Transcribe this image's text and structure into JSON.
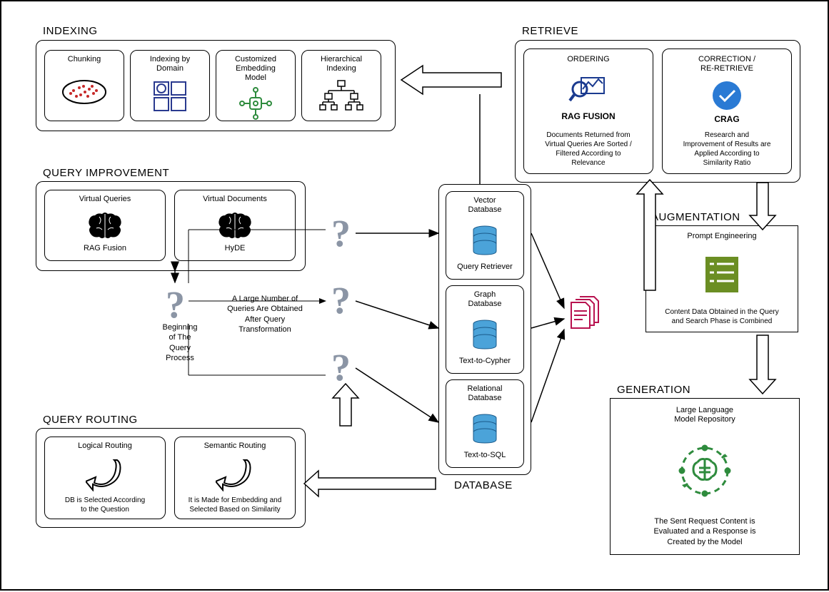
{
  "sections": {
    "indexing": {
      "title": "INDEXING"
    },
    "query_improvement": {
      "title": "QUERY IMPROVEMENT"
    },
    "query_routing": {
      "title": "QUERY ROUTING"
    },
    "retrieve": {
      "title": "RETRIEVE"
    },
    "augmentation": {
      "title": "AUGMENTATION"
    },
    "generation": {
      "title": "GENERATION"
    },
    "database": {
      "title": "DATABASE"
    }
  },
  "indexing": {
    "chunking": "Chunking",
    "by_domain": "Indexing by\nDomain",
    "embedding": "Customized\nEmbedding\nModel",
    "hierarchical": "Hierarchical\nIndexing"
  },
  "query_improvement": {
    "virtual_queries": {
      "top": "Virtual Queries",
      "bottom": "RAG Fusion"
    },
    "virtual_documents": {
      "top": "Virtual Documents",
      "bottom": "HyDE"
    }
  },
  "query_routing": {
    "logical": {
      "top": "Logical Routing",
      "bottom": "DB is Selected According\nto the Question"
    },
    "semantic": {
      "top": "Semantic Routing",
      "bottom": "It is Made for Embedding and\nSelected Based on Similarity"
    }
  },
  "retrieve": {
    "ordering": {
      "title": "ORDERING",
      "name": "RAG FUSION",
      "desc": "Documents Returned from\nVirtual Queries Are Sorted /\nFiltered According to\nRelevance"
    },
    "correction": {
      "title": "CORRECTION /\nRE-RETRIEVE",
      "name": "CRAG",
      "desc": "Research and\nImprovement of Results are\nApplied According to\nSimilarity Ratio"
    }
  },
  "database": {
    "vector": {
      "top": "Vector\nDatabase",
      "bottom": "Query Retriever"
    },
    "graph": {
      "top": "Graph\nDatabase",
      "bottom": "Text-to-Cypher"
    },
    "relational": {
      "top": "Relational\nDatabase",
      "bottom": "Text-to-SQL"
    }
  },
  "augmentation": {
    "title": "Prompt Engineering",
    "desc": "Content Data Obtained in the Query\nand Search Phase is Combined"
  },
  "generation": {
    "title": "Large Language\nModel Repository",
    "desc": "The Sent Request Content is\nEvaluated and a Response is\nCreated by the Model"
  },
  "free_text": {
    "beginning": "Beginning\nof The\nQuery\nProcess",
    "large_number": "A Large Number of\nQueries Are Obtained\nAfter Query\nTransformation"
  }
}
